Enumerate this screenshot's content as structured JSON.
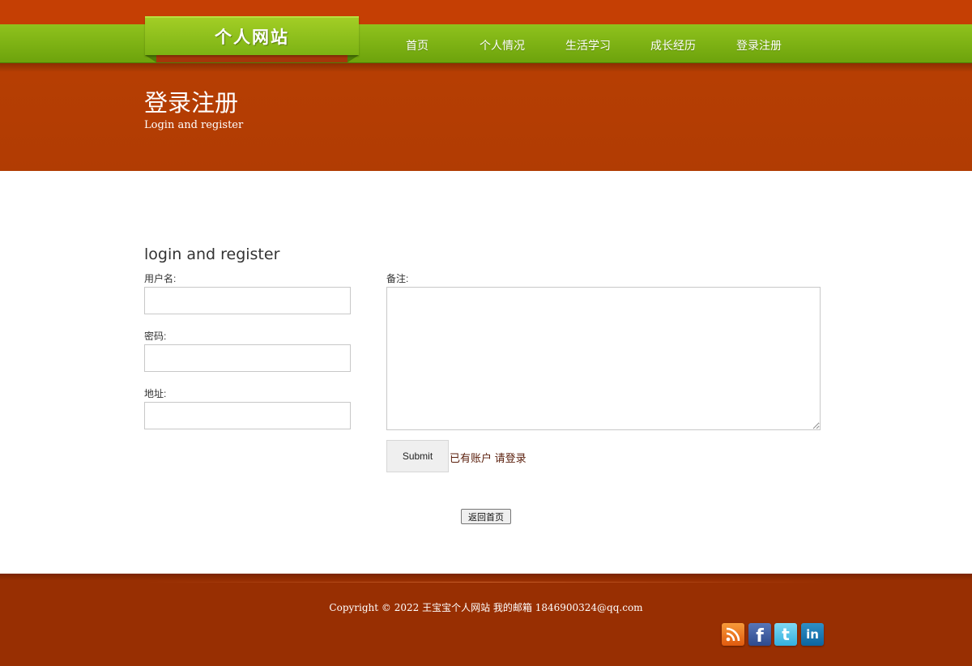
{
  "header": {
    "logo_text": "个人网站",
    "nav": [
      "首页",
      "个人情况",
      "生活学习",
      "成长经历",
      "登录注册"
    ]
  },
  "banner": {
    "title": "登录注册",
    "subtitle": "Login and register"
  },
  "form": {
    "heading": "login and register",
    "username_label": "用户名:",
    "password_label": "密码:",
    "address_label": "地址:",
    "memo_label": "备注:",
    "submit_label": "Submit",
    "login_link": "已有账户 请登录",
    "home_button": "返回首页"
  },
  "footer": {
    "copyright": "Copyright © 2022 王宝宝个人网站 我的邮箱 1846900324@qq.com",
    "social_icons": [
      "rss-icon",
      "facebook-icon",
      "twitter-icon",
      "linkedin-icon"
    ]
  },
  "colors": {
    "header_orange": "#c53f04",
    "nav_green": "#7cb214",
    "banner_rust": "#b13c03",
    "footer_brown": "#982f02"
  }
}
